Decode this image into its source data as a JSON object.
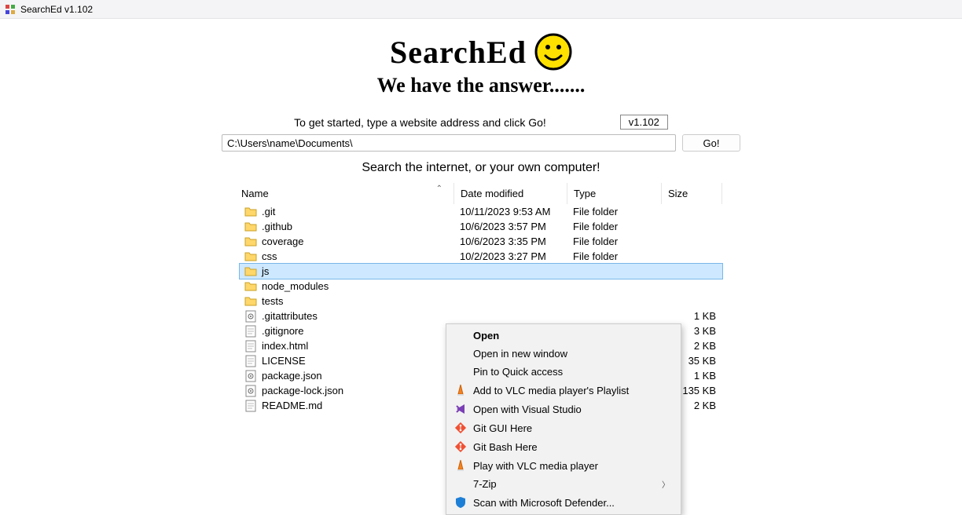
{
  "window": {
    "title": "SearchEd v1.102"
  },
  "header": {
    "logo": "SearchEd",
    "tagline": "We have the answer.......",
    "hint": "To get started, type a website address and click Go!",
    "version": "v1.102"
  },
  "search": {
    "value": "C:\\Users\\name\\Documents\\",
    "go_label": "Go!"
  },
  "subhead": "Search the internet, or your own computer!",
  "columns": {
    "name": "Name",
    "date": "Date modified",
    "type": "Type",
    "size": "Size"
  },
  "rows": [
    {
      "icon": "folder",
      "name": ".git",
      "date": "10/11/2023 9:53 AM",
      "type": "File folder",
      "size": "",
      "selected": false
    },
    {
      "icon": "folder",
      "name": ".github",
      "date": "10/6/2023 3:57 PM",
      "type": "File folder",
      "size": "",
      "selected": false
    },
    {
      "icon": "folder",
      "name": "coverage",
      "date": "10/6/2023 3:35 PM",
      "type": "File folder",
      "size": "",
      "selected": false
    },
    {
      "icon": "folder",
      "name": "css",
      "date": "10/2/2023 3:27 PM",
      "type": "File folder",
      "size": "",
      "selected": false
    },
    {
      "icon": "folder",
      "name": "js",
      "date": "",
      "type": "",
      "size": "",
      "selected": true
    },
    {
      "icon": "folder",
      "name": "node_modules",
      "date": "",
      "type": "",
      "size": "",
      "selected": false
    },
    {
      "icon": "folder",
      "name": "tests",
      "date": "",
      "type": "",
      "size": "",
      "selected": false
    },
    {
      "icon": "gear-file",
      "name": ".gitattributes",
      "date": "",
      "type": "",
      "size": "1 KB",
      "selected": false
    },
    {
      "icon": "file",
      "name": ".gitignore",
      "date": "",
      "type": "",
      "size": "3 KB",
      "selected": false
    },
    {
      "icon": "file",
      "name": "index.html",
      "date": "",
      "type": "",
      "size": "2 KB",
      "selected": false
    },
    {
      "icon": "file",
      "name": "LICENSE",
      "date": "",
      "type": "",
      "size": "35 KB",
      "selected": false
    },
    {
      "icon": "gear-file",
      "name": "package.json",
      "date": "",
      "type": "",
      "size": "1 KB",
      "selected": false
    },
    {
      "icon": "gear-file",
      "name": "package-lock.json",
      "date": "",
      "type": "",
      "size": "135 KB",
      "selected": false
    },
    {
      "icon": "file",
      "name": "README.md",
      "date": "",
      "type": "",
      "size": "2 KB",
      "selected": false
    }
  ],
  "context_menu": [
    {
      "icon": "",
      "label": "Open",
      "default": true
    },
    {
      "icon": "",
      "label": "Open in new window"
    },
    {
      "icon": "",
      "label": "Pin to Quick access"
    },
    {
      "icon": "vlc",
      "label": "Add to VLC media player's Playlist"
    },
    {
      "icon": "vs",
      "label": "Open with Visual Studio"
    },
    {
      "icon": "git",
      "label": "Git GUI Here"
    },
    {
      "icon": "git",
      "label": "Git Bash Here"
    },
    {
      "icon": "vlc",
      "label": "Play with VLC media player"
    },
    {
      "icon": "",
      "label": "7-Zip",
      "submenu": true
    },
    {
      "icon": "shield",
      "label": "Scan with Microsoft Defender..."
    }
  ]
}
